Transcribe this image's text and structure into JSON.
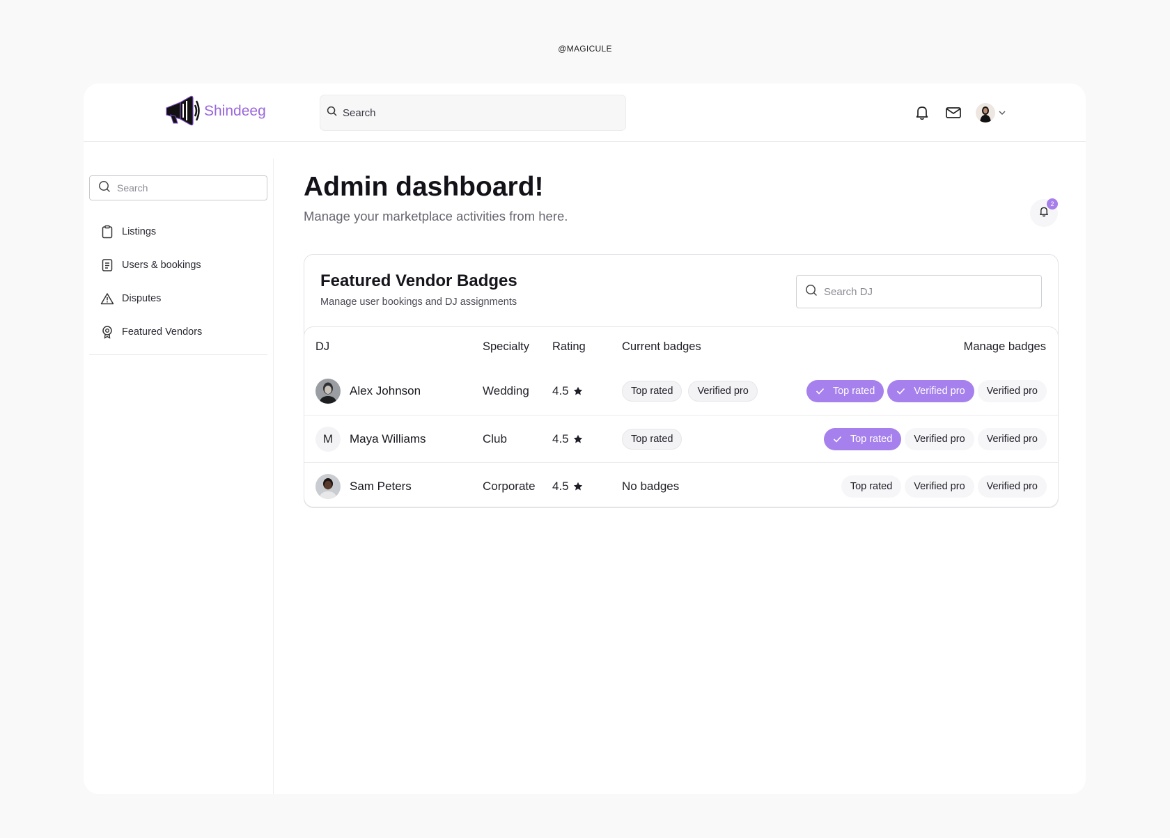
{
  "watermark": "@MAGICULE",
  "header": {
    "brand": "Shindeeg",
    "search_placeholder": "Search"
  },
  "sidebar": {
    "search_placeholder": "Search",
    "items": [
      {
        "label": "Listings",
        "icon": "clipboard-icon"
      },
      {
        "label": "Users & bookings",
        "icon": "receipt-icon"
      },
      {
        "label": "Disputes",
        "icon": "warning-icon"
      },
      {
        "label": "Featured Vendors",
        "icon": "badge-icon"
      }
    ]
  },
  "main": {
    "title": "Admin dashboard!",
    "subtitle": "Manage your marketplace activities from here.",
    "notification_count": "2"
  },
  "card": {
    "title": "Featured Vendor Badges",
    "subtitle": "Manage user bookings and DJ assignments",
    "search_placeholder": "Search DJ",
    "columns": {
      "dj": "DJ",
      "specialty": "Specialty",
      "rating": "Rating",
      "current_badges": "Current badges",
      "manage_badges": "Manage badges"
    },
    "rows": [
      {
        "name": "Alex Johnson",
        "avatar": "photo",
        "specialty": "Wedding",
        "rating": "4.5",
        "current": [
          "Top rated",
          "Verified pro"
        ],
        "manage": [
          {
            "label": "Top rated",
            "active": true
          },
          {
            "label": "Verified pro",
            "active": true
          },
          {
            "label": "Verified pro",
            "active": false
          }
        ]
      },
      {
        "name": "Maya Williams",
        "avatar": "M",
        "specialty": "Club",
        "rating": "4.5",
        "current": [
          "Top rated"
        ],
        "manage": [
          {
            "label": "Top rated",
            "active": true
          },
          {
            "label": "Verified pro",
            "active": false
          },
          {
            "label": "Verified pro",
            "active": false
          }
        ]
      },
      {
        "name": "Sam Peters",
        "avatar": "photo",
        "specialty": "Corporate",
        "rating": "4.5",
        "no_badges": "No badges",
        "manage": [
          {
            "label": "Top rated",
            "active": false
          },
          {
            "label": "Verified pro",
            "active": false
          },
          {
            "label": "Verified pro",
            "active": false
          }
        ]
      }
    ]
  },
  "colors": {
    "accent": "#a680ec",
    "brand_text": "#9a66dc"
  }
}
